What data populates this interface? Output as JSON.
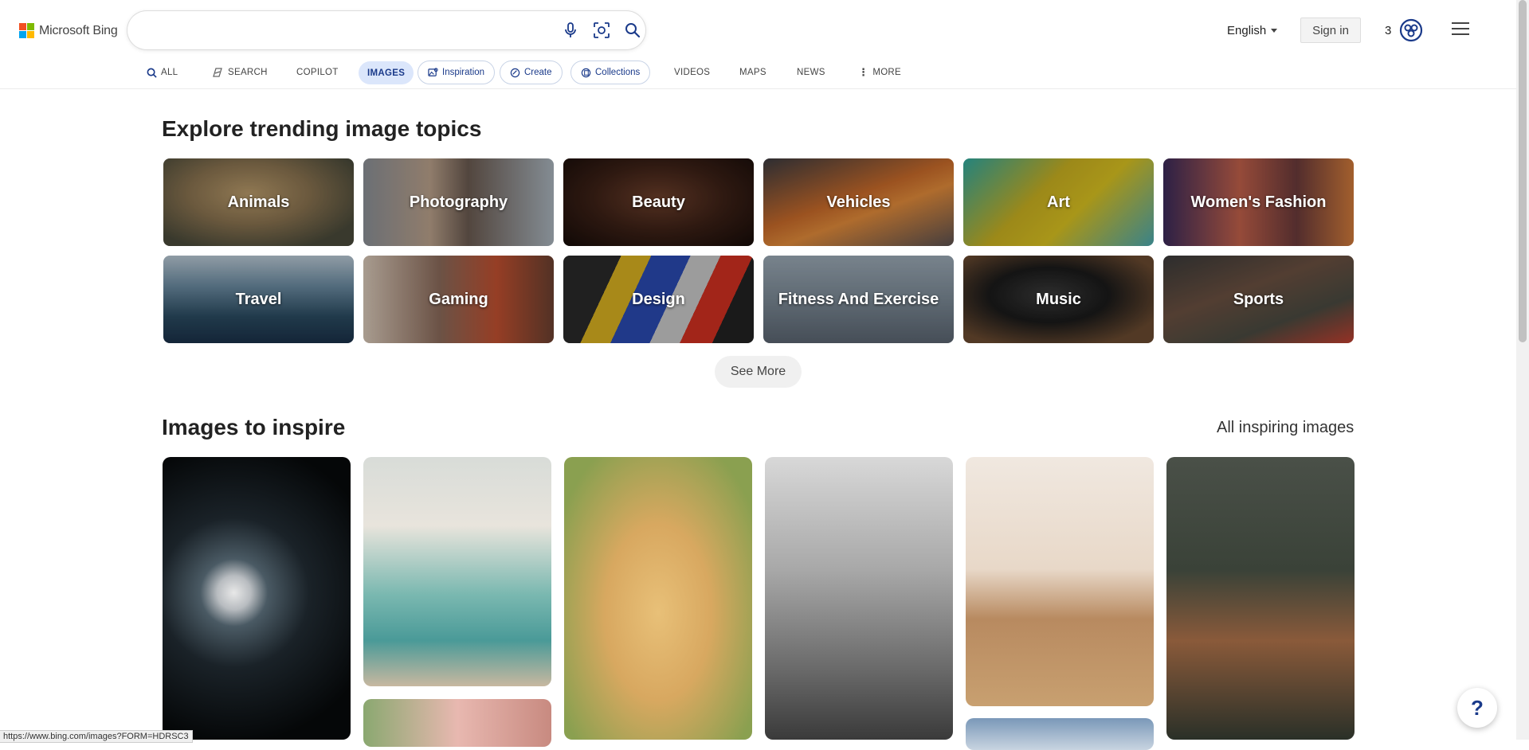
{
  "brand": {
    "name": "Microsoft Bing"
  },
  "search": {
    "value": "",
    "placeholder": ""
  },
  "header": {
    "language": "English",
    "sign_in": "Sign in",
    "rewards_count": "3"
  },
  "tabs": [
    {
      "label": "ALL",
      "icon": "search-icon"
    },
    {
      "label": "SEARCH",
      "icon": "copilot-search-icon"
    },
    {
      "label": "COPILOT"
    },
    {
      "label": "IMAGES",
      "active": true
    },
    {
      "label": "Inspiration",
      "icon": "inspiration-icon"
    },
    {
      "label": "Create",
      "icon": "create-icon"
    },
    {
      "label": "Collections",
      "icon": "collections-icon"
    },
    {
      "label": "VIDEOS"
    },
    {
      "label": "MAPS"
    },
    {
      "label": "NEWS"
    },
    {
      "label": "MORE",
      "icon": "more-vertical-icon"
    }
  ],
  "trending": {
    "title": "Explore trending image topics",
    "topics": [
      "Animals",
      "Photography",
      "Beauty",
      "Vehicles",
      "Art",
      "Women's Fashion",
      "Travel",
      "Gaming",
      "Design",
      "Fitness And Exercise",
      "Music",
      "Sports"
    ],
    "see_more": "See More"
  },
  "inspire": {
    "title": "Images to inspire",
    "all_link": "All inspiring images"
  },
  "status_url": "https://www.bing.com/images?FORM=HDRSC3",
  "help": {
    "label": "?"
  },
  "colors": {
    "accent": "#1a3a8a",
    "active_tab_bg": "#dbe6fb"
  }
}
